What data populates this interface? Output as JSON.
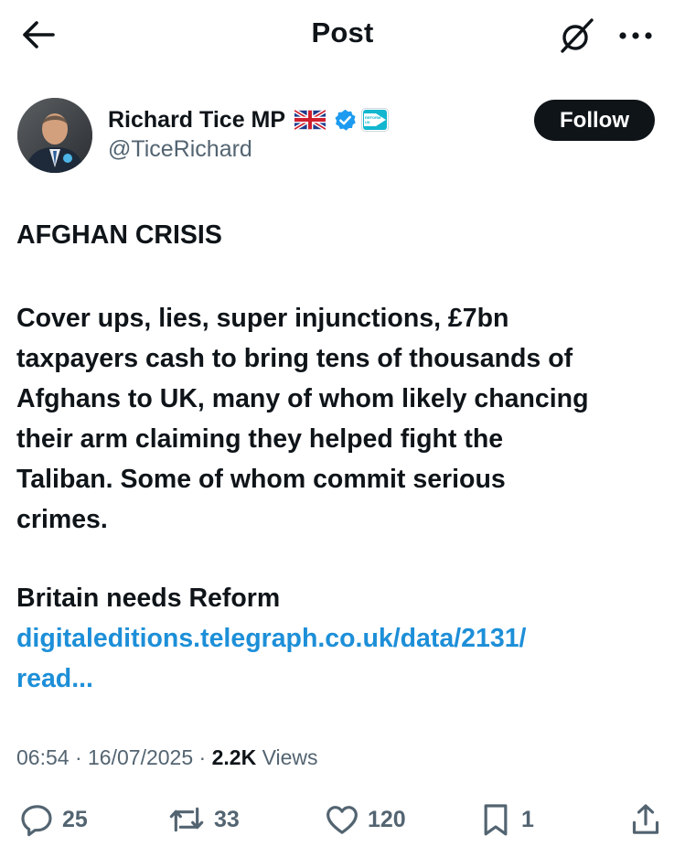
{
  "header": {
    "title": "Post",
    "back_icon": "arrow-left-icon",
    "grok_icon": "grok-icon",
    "more_icon": "more-icon"
  },
  "author": {
    "name": "Richard Tice MP",
    "handle": "@TiceRichard",
    "follow_label": "Follow",
    "flag_icon": "uk-flag-icon",
    "verified_icon": "verified-badge-icon",
    "affiliation_icon": "reform-uk-icon",
    "affiliation_label": "REFORM UK"
  },
  "post": {
    "headline": "AFGHAN CRISIS",
    "paragraph_lines": [
      "Cover ups, lies, super injunctions, £7bn",
      "taxpayers cash to bring tens of thousands of",
      "Afghans to UK, many of whom likely chancing",
      "their arm claiming they helped fight the",
      "Taliban. Some of whom commit serious",
      "crimes."
    ],
    "tagline": "Britain needs Reform",
    "link_lines": [
      "digitaleditions.telegraph.co.uk/data/2131/",
      "read..."
    ]
  },
  "meta": {
    "time": "06:54",
    "sep1": " · ",
    "date": "16/07/2025",
    "sep2": " · ",
    "views_count": "2.2K",
    "views_label": " Views"
  },
  "actions": {
    "replies": "25",
    "reposts": "33",
    "likes": "120",
    "bookmarks": "1"
  },
  "colors": {
    "link": "#1d8fd8",
    "text": "#0f1419",
    "muted": "#536471",
    "verified": "#1d9bf0"
  }
}
